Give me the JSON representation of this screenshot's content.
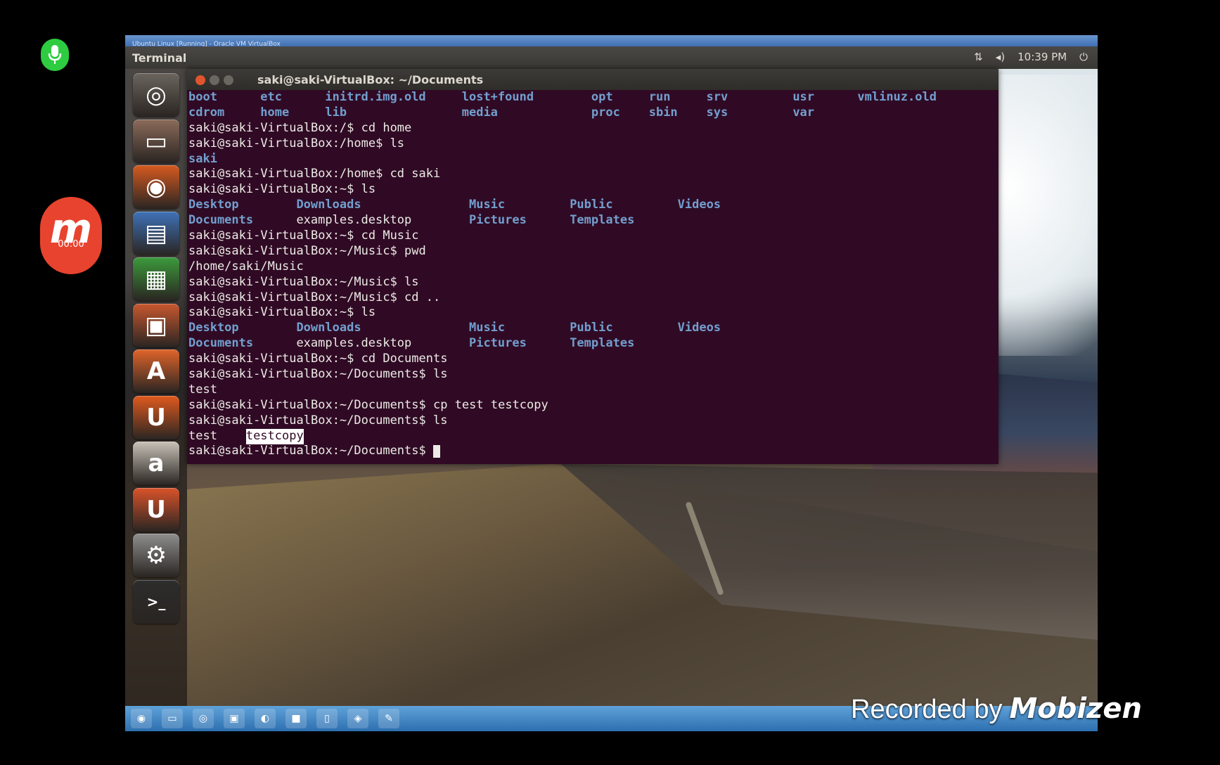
{
  "vbox": {
    "title": "Ubuntu Linux [Running] - Oracle VM VirtualBox"
  },
  "panel": {
    "app_name": "Terminal",
    "time": "10:39 PM"
  },
  "terminal": {
    "title": "saki@saki-VirtualBox: ~/Documents",
    "lines": [
      [
        [
          "boot",
          0,
          "dir"
        ],
        [
          "etc",
          10,
          "dir"
        ],
        [
          "initrd.img.old",
          19,
          "dir"
        ],
        [
          "lost+found",
          38,
          "dir"
        ],
        [
          "opt",
          56,
          "dir"
        ],
        [
          "run",
          64,
          "dir"
        ],
        [
          "srv",
          72,
          "dir"
        ],
        [
          "usr",
          84,
          "dir"
        ],
        [
          "vmlinuz.old",
          93,
          "dir"
        ]
      ],
      [
        [
          "cdrom",
          0,
          "dir"
        ],
        [
          "home",
          10,
          "dir"
        ],
        [
          "lib",
          19,
          "dir"
        ],
        [
          "media",
          38,
          "dir"
        ],
        [
          "proc",
          56,
          "dir"
        ],
        [
          "sbin",
          64,
          "dir"
        ],
        [
          "sys",
          72,
          "dir"
        ],
        [
          "var",
          84,
          "dir"
        ]
      ],
      [
        [
          "saki@saki-VirtualBox:/$ cd home",
          0,
          "file"
        ]
      ],
      [
        [
          "saki@saki-VirtualBox:/home$ ls",
          0,
          "file"
        ]
      ],
      [
        [
          "saki",
          0,
          "dir"
        ]
      ],
      [
        [
          "saki@saki-VirtualBox:/home$ cd saki",
          0,
          "file"
        ]
      ],
      [
        [
          "saki@saki-VirtualBox:~$ ls",
          0,
          "file"
        ]
      ],
      [
        [
          "Desktop",
          0,
          "dir"
        ],
        [
          "Downloads",
          15,
          "dir"
        ],
        [
          "Music",
          39,
          "dir"
        ],
        [
          "Public",
          53,
          "dir"
        ],
        [
          "Videos",
          68,
          "dir"
        ]
      ],
      [
        [
          "Documents",
          0,
          "dir"
        ],
        [
          "examples.desktop",
          15,
          "file"
        ],
        [
          "Pictures",
          39,
          "dir"
        ],
        [
          "Templates",
          53,
          "dir"
        ]
      ],
      [
        [
          "saki@saki-VirtualBox:~$ cd Music",
          0,
          "file"
        ]
      ],
      [
        [
          "saki@saki-VirtualBox:~/Music$ pwd",
          0,
          "file"
        ]
      ],
      [
        [
          "/home/saki/Music",
          0,
          "file"
        ]
      ],
      [
        [
          "saki@saki-VirtualBox:~/Music$ ls",
          0,
          "file"
        ]
      ],
      [
        [
          "saki@saki-VirtualBox:~/Music$ cd ..",
          0,
          "file"
        ]
      ],
      [
        [
          "saki@saki-VirtualBox:~$ ls",
          0,
          "file"
        ]
      ],
      [
        [
          "Desktop",
          0,
          "dir"
        ],
        [
          "Downloads",
          15,
          "dir"
        ],
        [
          "Music",
          39,
          "dir"
        ],
        [
          "Public",
          53,
          "dir"
        ],
        [
          "Videos",
          68,
          "dir"
        ]
      ],
      [
        [
          "Documents",
          0,
          "dir"
        ],
        [
          "examples.desktop",
          15,
          "file"
        ],
        [
          "Pictures",
          39,
          "dir"
        ],
        [
          "Templates",
          53,
          "dir"
        ]
      ],
      [
        [
          "saki@saki-VirtualBox:~$ cd Documents",
          0,
          "file"
        ]
      ],
      [
        [
          "saki@saki-VirtualBox:~/Documents$ ls",
          0,
          "file"
        ]
      ],
      [
        [
          "test",
          0,
          "file"
        ]
      ],
      [
        [
          "saki@saki-VirtualBox:~/Documents$ cp test testcopy",
          0,
          "file"
        ]
      ],
      [
        [
          "saki@saki-VirtualBox:~/Documents$ ls",
          0,
          "file"
        ]
      ],
      [
        [
          "test",
          0,
          "file"
        ],
        [
          "testcopy",
          8,
          "hl"
        ]
      ],
      [
        [
          "saki@saki-VirtualBox:~/Documents$ ",
          0,
          "file"
        ]
      ]
    ]
  },
  "launcher": [
    {
      "name": "dash-home-icon",
      "color": "#6b655e",
      "glyph": "◎"
    },
    {
      "name": "files-icon",
      "color": "#8b6b5a",
      "glyph": "▭"
    },
    {
      "name": "firefox-icon",
      "color": "#d65a20",
      "glyph": "◉"
    },
    {
      "name": "writer-icon",
      "color": "#3f72b8",
      "glyph": "▤"
    },
    {
      "name": "calc-icon",
      "color": "#3c9a3c",
      "glyph": "▦"
    },
    {
      "name": "impress-icon",
      "color": "#c7572f",
      "glyph": "▣"
    },
    {
      "name": "software-center-icon",
      "color": "#e0642a",
      "glyph": "A"
    },
    {
      "name": "ubuntu-one-icon",
      "color": "#e05a1e",
      "glyph": "U"
    },
    {
      "name": "amazon-icon",
      "color": "#c8c2b8",
      "glyph": "a"
    },
    {
      "name": "ubuntu-one-music-icon",
      "color": "#d9532a",
      "glyph": "U"
    },
    {
      "name": "system-settings-icon",
      "color": "#8f8f8f",
      "glyph": "⚙"
    },
    {
      "name": "terminal-icon",
      "color": "#2c2c2c",
      "glyph": ">_"
    }
  ],
  "taskbar": [
    "start-orb-icon",
    "explorer-icon",
    "chrome-icon",
    "app-icon",
    "media-icon",
    "folder-icon",
    "word-icon",
    "network-icon",
    "tool-icon"
  ],
  "watermark": {
    "prefix": "Recorded by",
    "brand": "Mobizen"
  },
  "mobizen_timer": "00:00"
}
